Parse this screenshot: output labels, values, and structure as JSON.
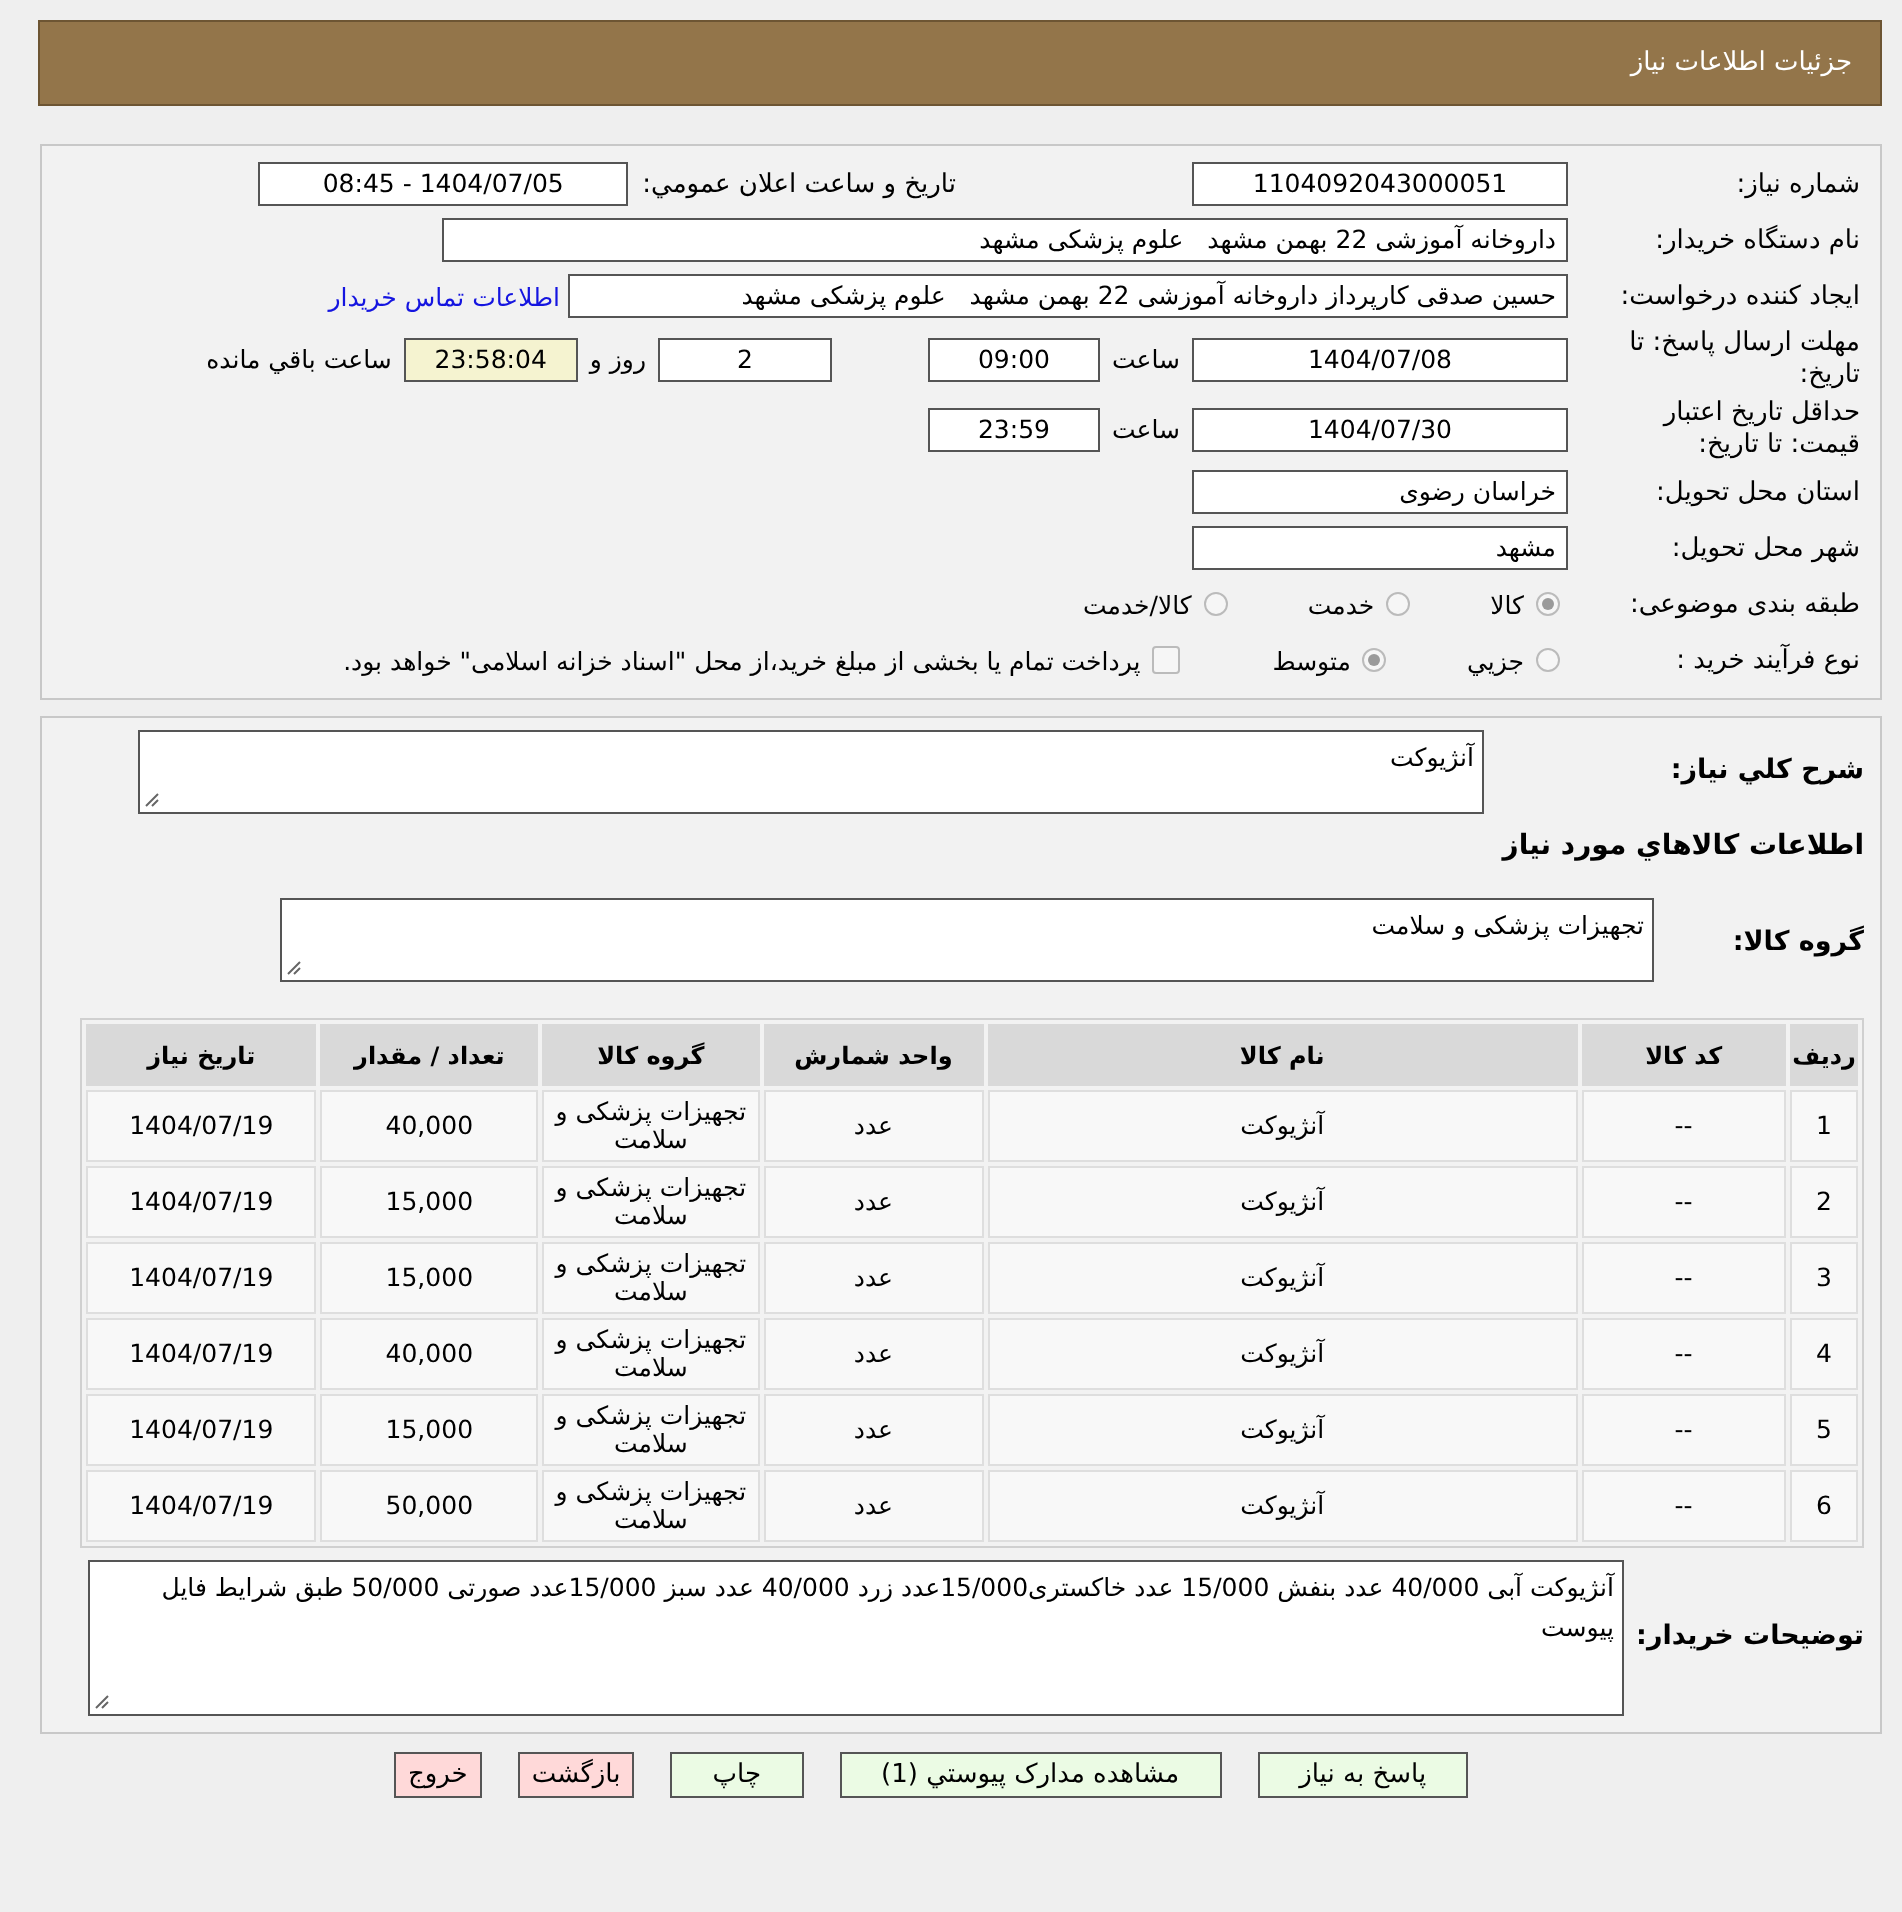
{
  "header": {
    "title": "جزئیات اطلاعات نیاز"
  },
  "details": {
    "need_number": {
      "label": "شماره نیاز:",
      "value": "1104092043000051"
    },
    "announce": {
      "label": "تاریخ و ساعت اعلان عمومي:",
      "value": "1404/07/05 - 08:45"
    },
    "buyer": {
      "label": "نام دستگاه خریدار:",
      "value": "داروخانه آموزشی 22 بهمن مشهد   علوم پزشکی مشهد"
    },
    "requester": {
      "label": "ایجاد کننده درخواست:",
      "value": "حسین صدقی کارپرداز داروخانه آموزشی 22 بهمن مشهد   علوم پزشکی مشهد",
      "link": "اطلاعات تماس خریدار"
    },
    "deadline": {
      "label": "مهلت ارسال پاسخ: تا تاریخ:",
      "date": "1404/07/08",
      "time_label": "ساعت",
      "time": "09:00",
      "days": "2",
      "days_label": "روز و",
      "remaining": "23:58:04",
      "remaining_label": "ساعت باقي مانده"
    },
    "validity": {
      "label": "حداقل تاریخ اعتبار قیمت: تا تاریخ:",
      "date": "1404/07/30",
      "time_label": "ساعت",
      "time": "23:59"
    },
    "province": {
      "label": "استان محل تحویل:",
      "value": "خراسان رضوی"
    },
    "city": {
      "label": "شهر محل تحویل:",
      "value": "مشهد"
    },
    "category": {
      "label": "طبقه بندی موضوعی:",
      "options": [
        {
          "label": "کالا",
          "selected": true
        },
        {
          "label": "خدمت",
          "selected": false
        },
        {
          "label": "کالا/خدمت",
          "selected": false
        }
      ]
    },
    "process": {
      "label": "نوع فرآیند خرید :",
      "options": [
        {
          "label": "جزيي",
          "selected": false
        },
        {
          "label": "متوسط",
          "selected": true
        }
      ],
      "payment": {
        "checked": false,
        "text": "پرداخت تمام یا بخشی از مبلغ خرید،از محل \"اسناد خزانه اسلامی\" خواهد بود."
      }
    }
  },
  "summary": {
    "label": "شرح کلي نیاز:",
    "value": "آنژیوکت"
  },
  "goods_heading": "اطلاعات کالاهاي مورد نیاز",
  "goods_group": {
    "label": "گروه کالا:",
    "value": "تجهیزات پزشکی و سلامت"
  },
  "table": {
    "columns": [
      "ردیف",
      "کد کالا",
      "نام کالا",
      "واحد شمارش",
      "گروه کالا",
      "تعداد / مقدار",
      "تاریخ نیاز"
    ],
    "rows": [
      [
        "1",
        "--",
        "آنژیوکت",
        "عدد",
        "تجهیزات پزشکی و سلامت",
        "40,000",
        "1404/07/19"
      ],
      [
        "2",
        "--",
        "آنژیوکت",
        "عدد",
        "تجهیزات پزشکی و سلامت",
        "15,000",
        "1404/07/19"
      ],
      [
        "3",
        "--",
        "آنژیوکت",
        "عدد",
        "تجهیزات پزشکی و سلامت",
        "15,000",
        "1404/07/19"
      ],
      [
        "4",
        "--",
        "آنژیوکت",
        "عدد",
        "تجهیزات پزشکی و سلامت",
        "40,000",
        "1404/07/19"
      ],
      [
        "5",
        "--",
        "آنژیوکت",
        "عدد",
        "تجهیزات پزشکی و سلامت",
        "15,000",
        "1404/07/19"
      ],
      [
        "6",
        "--",
        "آنژیوکت",
        "عدد",
        "تجهیزات پزشکی و سلامت",
        "50,000",
        "1404/07/19"
      ]
    ]
  },
  "buyer_notes": {
    "label": "توضیحات خریدار:",
    "value": "آنژیوکت آبی 40/000 عدد بنفش 15/000 عدد خاکستری15/000عدد زرد 40/000 عدد سبز 15/000عدد صورتی 50/000 طبق شرایط فایل پیوست"
  },
  "buttons": [
    {
      "label": "پاسخ به نیاز",
      "kind": "action"
    },
    {
      "label": "مشاهده مدارک پیوستي (1)",
      "kind": "action"
    },
    {
      "label": "چاپ",
      "kind": "action"
    },
    {
      "label": "بازگشت",
      "kind": "exit"
    },
    {
      "label": "خروج",
      "kind": "exit"
    }
  ]
}
